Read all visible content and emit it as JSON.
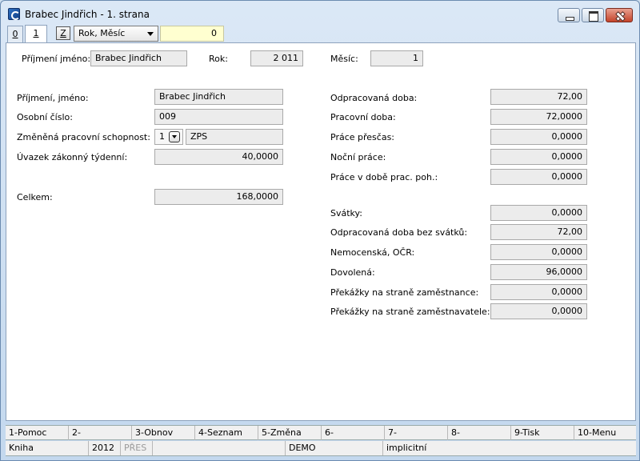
{
  "window": {
    "title": "Brabec Jindřich - 1. strana"
  },
  "toolbar": {
    "tab0": "0",
    "tab1": "1",
    "z_button": "Z",
    "period_selected": "Rok, Měsíc",
    "period_value": "0"
  },
  "header": {
    "name_label": "Příjmení jméno:",
    "name_value": "Brabec Jindřich",
    "year_label": "Rok:",
    "year_value": "2 011",
    "month_label": "Měsíc:",
    "month_value": "1"
  },
  "left": {
    "name_label": "Příjmení, jméno:",
    "name_value": "Brabec Jindřich",
    "personal_no_label": "Osobní číslo:",
    "personal_no_value": "009",
    "capacity_label": "Změněná pracovní schopnost:",
    "capacity_code": "1",
    "capacity_text": "ZPS",
    "weekly_label": "Úvazek zákonný týdenní:",
    "weekly_value": "40,0000",
    "total_label": "Celkem:",
    "total_value": "168,0000"
  },
  "right": {
    "worked_label": "Odpracovaná doba:",
    "worked_value": "72,00",
    "working_time_label": "Pracovní doba:",
    "working_time_value": "72,0000",
    "overtime_label": "Práce přesčas:",
    "overtime_value": "0,0000",
    "night_label": "Noční práce:",
    "night_value": "0,0000",
    "standby_label": "Práce v době prac. poh.:",
    "standby_value": "0,0000",
    "holidays_label": "Svátky:",
    "holidays_value": "0,0000",
    "worked_no_holidays_label": "Odpracovaná doba bez svátků:",
    "worked_no_holidays_value": "72,00",
    "sick_label": "Nemocenská, OČR:",
    "sick_value": "0,0000",
    "vacation_label": "Dovolená:",
    "vacation_value": "96,0000",
    "obstacle_employee_label": "Překážky na straně zaměstnance:",
    "obstacle_employee_value": "0,0000",
    "obstacle_employer_label": "Překážky na straně zaměstnavatele:",
    "obstacle_employer_value": "0,0000"
  },
  "fkeys": [
    "1-Pomoc",
    "2-",
    "3-Obnov",
    "4-Seznam",
    "5-Změna",
    "6-",
    "7-",
    "8-",
    "9-Tisk",
    "10-Menu"
  ],
  "status": {
    "book": "Kniha",
    "year": "2012",
    "mode": "PŘES",
    "db": "DEMO",
    "profile": "implicitní"
  }
}
